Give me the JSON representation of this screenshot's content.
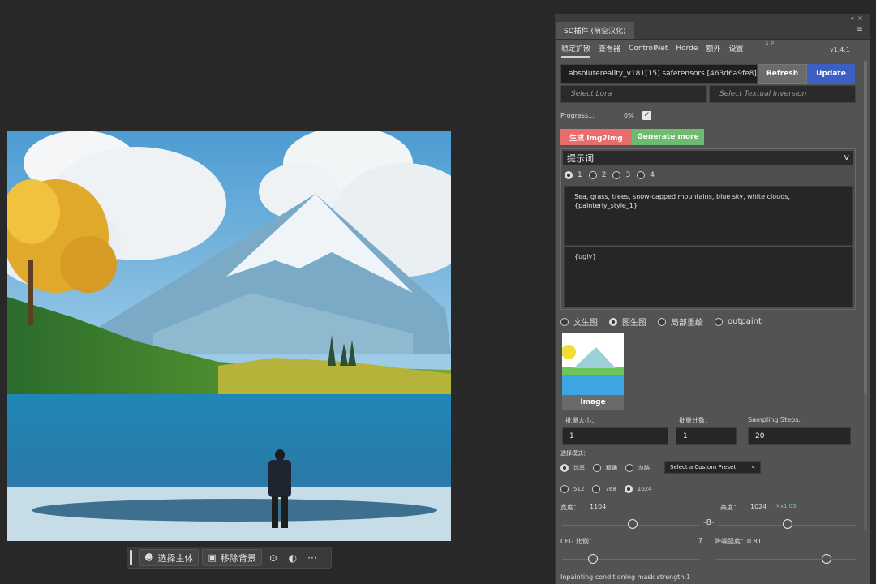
{
  "toolbar": {
    "select_subject": "选择主体",
    "remove_bg": "移除背景",
    "more": "···"
  },
  "panel": {
    "title": "SD插件 (萌空汉化)",
    "tabs": [
      "稳定扩散",
      "查看器",
      "ControlNet",
      "Horde",
      "额外",
      "设置"
    ],
    "tab_badge": "A P",
    "version": "v1.4.1",
    "model": "absolutereality_v181[15].safetensors [463d6a9fe8]",
    "refresh": "Refresh",
    "update": "Update",
    "lora_placeholder": "Select Lora",
    "ti_placeholder": "Select Textual Inversion",
    "progress_label": "Progress...",
    "progress_value": "0%",
    "generate": "生成 Img2Img",
    "generate_more": "Generate more",
    "prompt_header": "提示词",
    "prompt_chevron": "v",
    "prompt_slots": [
      "1",
      "2",
      "3",
      "4"
    ],
    "positive_prompt": "Sea, grass, trees, snow-capped mountains, blue sky, white clouds, {painterly_style_1}",
    "negative_prompt": "{ugly}",
    "modes": [
      "文生图",
      "图生图",
      "局部重绘",
      "outpaint"
    ],
    "image_label": "Image",
    "batch_size_label": "批量大小：",
    "batch_size": "1",
    "batch_count_label": "批量计数：",
    "batch_count": "1",
    "steps_label": "Sampling Steps:",
    "steps": "20",
    "select_mode_label": "选择模式：",
    "ratio_options": [
      "比率",
      "精确",
      "忽略"
    ],
    "preset": "Select a Custom Preset",
    "size_options": [
      "512",
      "768",
      "1024"
    ],
    "width_label": "宽度：",
    "width": "1104",
    "height_label": "高度：",
    "height": "1024",
    "scale_note": "+x1.03",
    "cfg_label": "CFG 比例：",
    "cfg": "7",
    "denoise_label": "降噪强度：0.81",
    "mask_label": "Inpainting conditioning mask strength:1"
  },
  "colors": {
    "refresh": "#6b6b6b",
    "update": "#3b5fc5",
    "generate": "#e86d6d",
    "generate_more": "#6dbb6f",
    "accent_green": "#6fcf7a"
  }
}
